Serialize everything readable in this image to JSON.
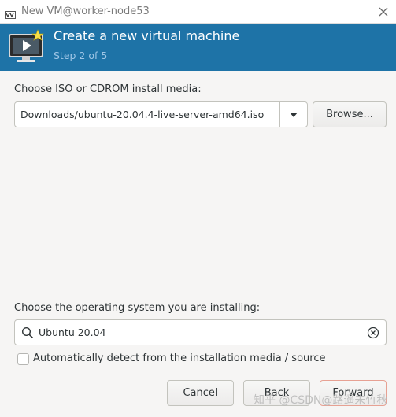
{
  "window": {
    "title": "New VM@worker-node53"
  },
  "banner": {
    "title": "Create a new virtual machine",
    "step": "Step 2 of 5"
  },
  "install_media": {
    "label": "Choose ISO or CDROM install media:",
    "selected_value": "Downloads/ubuntu-20.04.4-live-server-amd64.iso",
    "browse_label": "Browse..."
  },
  "os": {
    "label": "Choose the operating system you are installing:",
    "search_value": "Ubuntu 20.04",
    "auto_detect_label": "Automatically detect from the installation media / source",
    "auto_detect_checked": false
  },
  "footer": {
    "cancel_label": "Cancel",
    "back_label": "Back",
    "forward_label": "Forward"
  },
  "watermark": "知乎 @CSDN@路遥未竹秋",
  "colors": {
    "banner": "#1e73a7",
    "step_text": "#9fc6e6",
    "window_bg": "#f6f5f4"
  },
  "icons": {
    "app": "virt-manager-icon",
    "banner": "vm-monitor-play-icon",
    "close": "close-icon",
    "dropdown": "chevron-down-icon",
    "search": "search-icon",
    "clear": "clear-icon"
  }
}
